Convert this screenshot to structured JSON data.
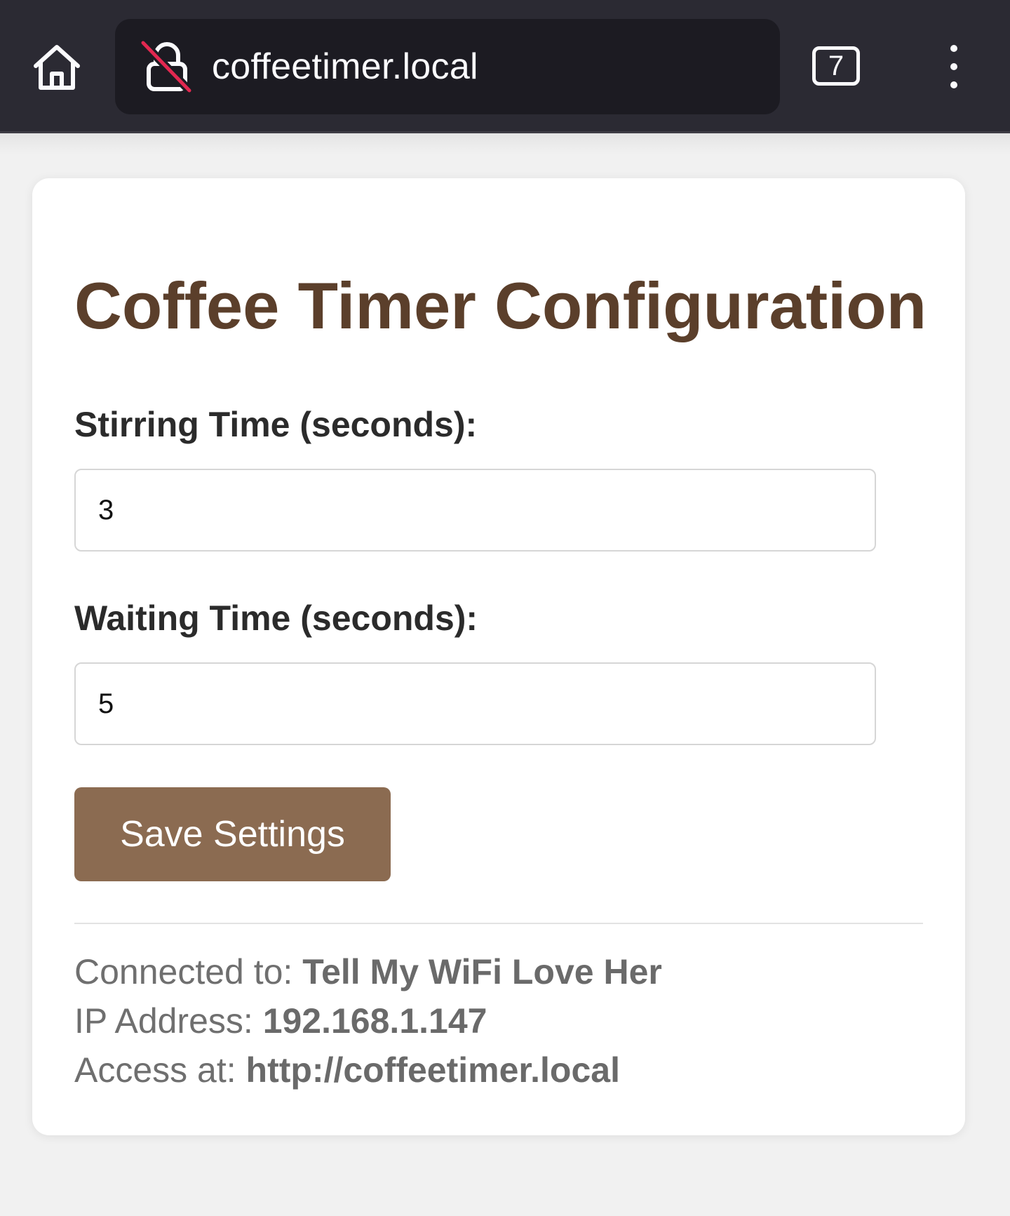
{
  "browser": {
    "url": "coffeetimer.local",
    "tab_count": "7",
    "icons": {
      "home": "home-icon",
      "lock": "insecure-lock-icon",
      "menu": "more-vertical-icon"
    }
  },
  "page": {
    "title": "Coffee Timer Configuration",
    "stirring": {
      "label": "Stirring Time (seconds):",
      "value": "3"
    },
    "waiting": {
      "label": "Waiting Time (seconds):",
      "value": "5"
    },
    "save_label": "Save Settings",
    "info": {
      "wifi_label": "Connected to: ",
      "wifi_value": "Tell My WiFi Love Her",
      "ip_label": "IP Address: ",
      "ip_value": "192.168.1.147",
      "access_label": "Access at: ",
      "access_value": "http://coffeetimer.local"
    }
  },
  "colors": {
    "title": "#5b3f2b",
    "button": "#8b6b51",
    "toolbar": "#2b2a33",
    "urlbar": "#1c1b22",
    "insecure_slash": "#e22850"
  }
}
